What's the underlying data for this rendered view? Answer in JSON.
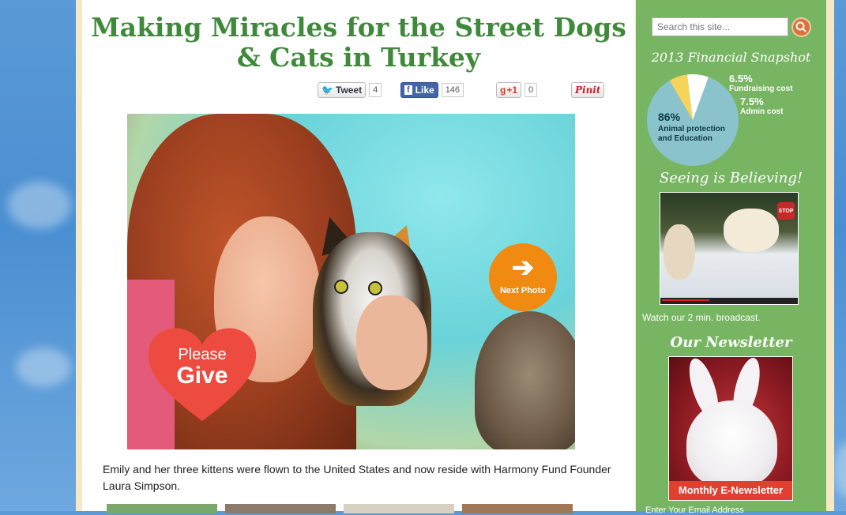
{
  "article": {
    "title": "Making Miracles for the Street Dogs & Cats in Turkey",
    "caption": "Emily and her three kittens were flown to the United States and now reside with Harmony Fund Founder Laura Simpson."
  },
  "social": {
    "tweet_label": "Tweet",
    "tweet_count": "4",
    "like_label": "Like",
    "like_count": "146",
    "gplus_label": "+1",
    "gplus_count": "0",
    "pinit_label": "Pinit"
  },
  "photo": {
    "give_line1": "Please",
    "give_line2": "Give",
    "next_arrow": "➔",
    "next_label": "Next Photo"
  },
  "sidebar": {
    "search_placeholder": "Search this site...",
    "snapshot_title": "2013 Financial Snapshot",
    "pie": {
      "slices": [
        {
          "label": "Animal protection and Education",
          "percent": 86,
          "color": "#8bc3cc"
        },
        {
          "label": "Fundraising cost",
          "percent": 6.5,
          "color": "#f6d35a"
        },
        {
          "label": "Admin cost",
          "percent": 7.5,
          "color": "#ffffff"
        }
      ],
      "main_pct": "86%",
      "main_label_1": "Animal protection",
      "main_label_2": "and Education",
      "fund_pct": "6.5%",
      "fund_label": "Fundraising cost",
      "admin_pct": "7.5%",
      "admin_label": "Admin cost"
    },
    "seeing_title": "Seeing is Believing!",
    "stop_text": "STOP",
    "video_caption": "Watch our 2 min. broadcast.",
    "newsletter_title": "Our Newsletter",
    "newsletter_band": "Monthly E-Newsletter",
    "email_label": "Enter Your Email Address"
  },
  "colors": {
    "title_green": "#3f8a3a",
    "sidebar_green": "#78b562",
    "give_red": "#ee4b40",
    "next_orange": "#f08a10"
  }
}
